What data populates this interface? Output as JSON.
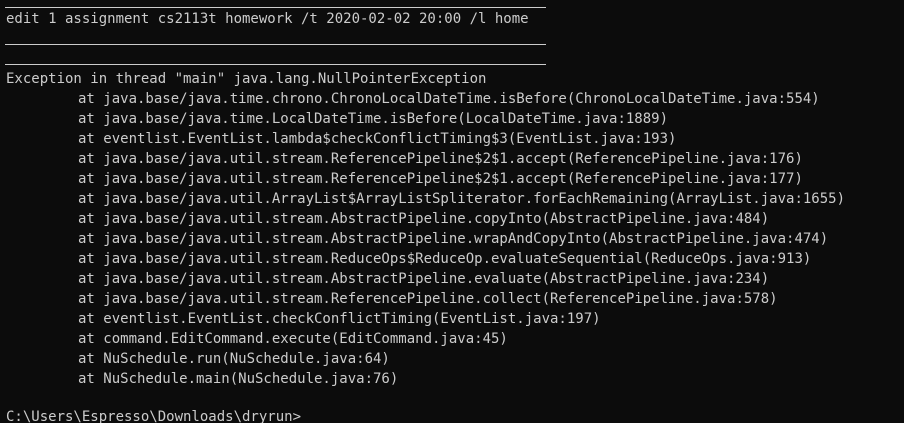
{
  "command": "edit 1 assignment cs2113t homework /t 2020-02-02 20:00 /l home",
  "exception": "Exception in thread \"main\" java.lang.NullPointerException",
  "stack_trace": [
    "at java.base/java.time.chrono.ChronoLocalDateTime.isBefore(ChronoLocalDateTime.java:554)",
    "at java.base/java.time.LocalDateTime.isBefore(LocalDateTime.java:1889)",
    "at eventlist.EventList.lambda$checkConflictTiming$3(EventList.java:193)",
    "at java.base/java.util.stream.ReferencePipeline$2$1.accept(ReferencePipeline.java:176)",
    "at java.base/java.util.stream.ReferencePipeline$2$1.accept(ReferencePipeline.java:177)",
    "at java.base/java.util.ArrayList$ArrayListSpliterator.forEachRemaining(ArrayList.java:1655)",
    "at java.base/java.util.stream.AbstractPipeline.copyInto(AbstractPipeline.java:484)",
    "at java.base/java.util.stream.AbstractPipeline.wrapAndCopyInto(AbstractPipeline.java:474)",
    "at java.base/java.util.stream.ReduceOps$ReduceOp.evaluateSequential(ReduceOps.java:913)",
    "at java.base/java.util.stream.AbstractPipeline.evaluate(AbstractPipeline.java:234)",
    "at java.base/java.util.stream.ReferencePipeline.collect(ReferencePipeline.java:578)",
    "at eventlist.EventList.checkConflictTiming(EventList.java:197)",
    "at command.EditCommand.execute(EditCommand.java:45)",
    "at NuSchedule.run(NuSchedule.java:64)",
    "at NuSchedule.main(NuSchedule.java:76)"
  ],
  "prompt": "C:\\Users\\Espresso\\Downloads\\dryrun>",
  "colors": {
    "background": "#0c0c0c",
    "foreground": "#cccccc"
  }
}
